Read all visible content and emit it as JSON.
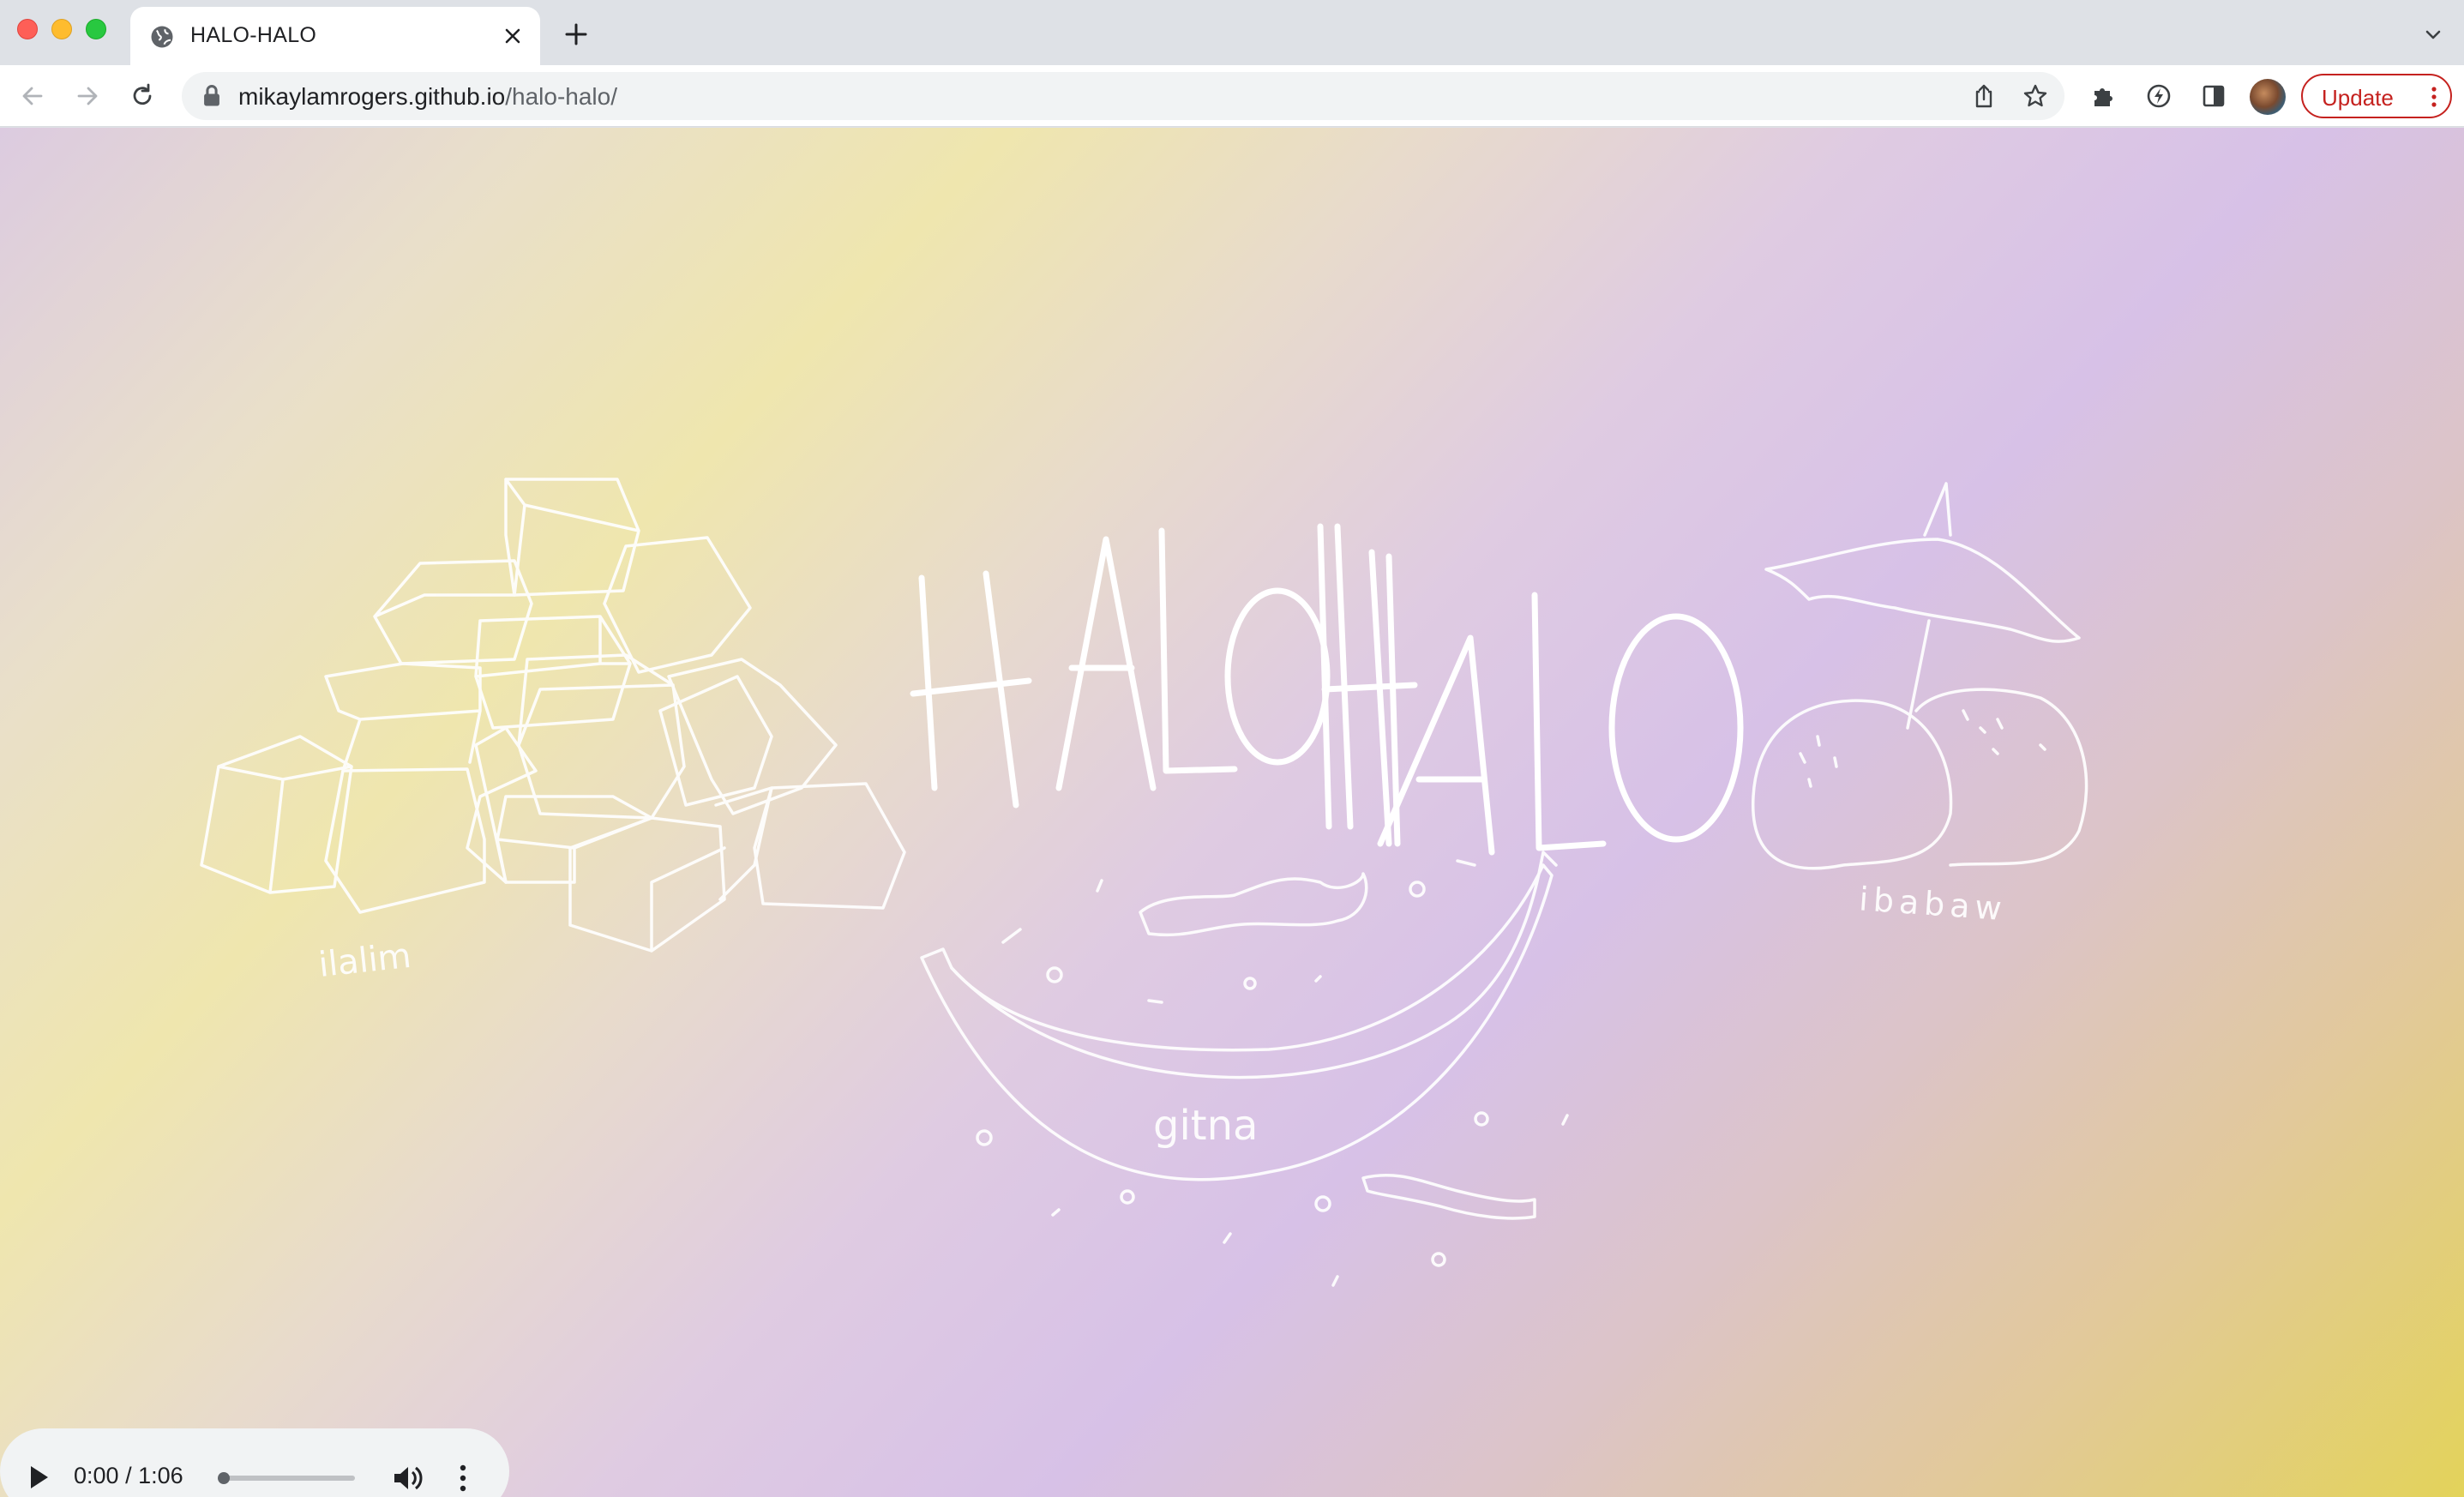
{
  "browser": {
    "tab": {
      "title": "HALO-HALO",
      "favicon": "globe-icon",
      "close_icon": "close-icon"
    },
    "new_tab_icon": "plus-icon",
    "tab_menu_icon": "chevron-down-icon",
    "nav": {
      "back": "back-arrow-icon",
      "forward": "forward-arrow-icon",
      "reload": "reload-icon"
    },
    "address": {
      "domain": "mikaylamrogers.github.io",
      "path": "/halo-halo/",
      "lock_icon": "lock-icon"
    },
    "omnibox_actions": [
      "share-icon",
      "star-icon"
    ],
    "extensions": [
      "puzzle-icon",
      "bolt-icon",
      "side-panel-icon"
    ],
    "update_label": "Update",
    "colors": {
      "tabstrip": "#dee1e6",
      "update": "#c5221f"
    }
  },
  "page": {
    "title_art": "HALOHALO",
    "labels": {
      "ice": "ilalim",
      "banana": "gitna",
      "mochi": "ibabaw"
    },
    "colors": {
      "stroke": "#ffffff",
      "gradient": [
        "#dccbe0",
        "#efe6ae",
        "#d7c1e7",
        "#e3d35a"
      ]
    }
  },
  "audio": {
    "time_current": "0:00",
    "separator": " / ",
    "time_total": "1:06",
    "progress": 0.0,
    "icons": {
      "play": "play-icon",
      "volume": "volume-icon",
      "more": "more-vert-icon"
    }
  }
}
